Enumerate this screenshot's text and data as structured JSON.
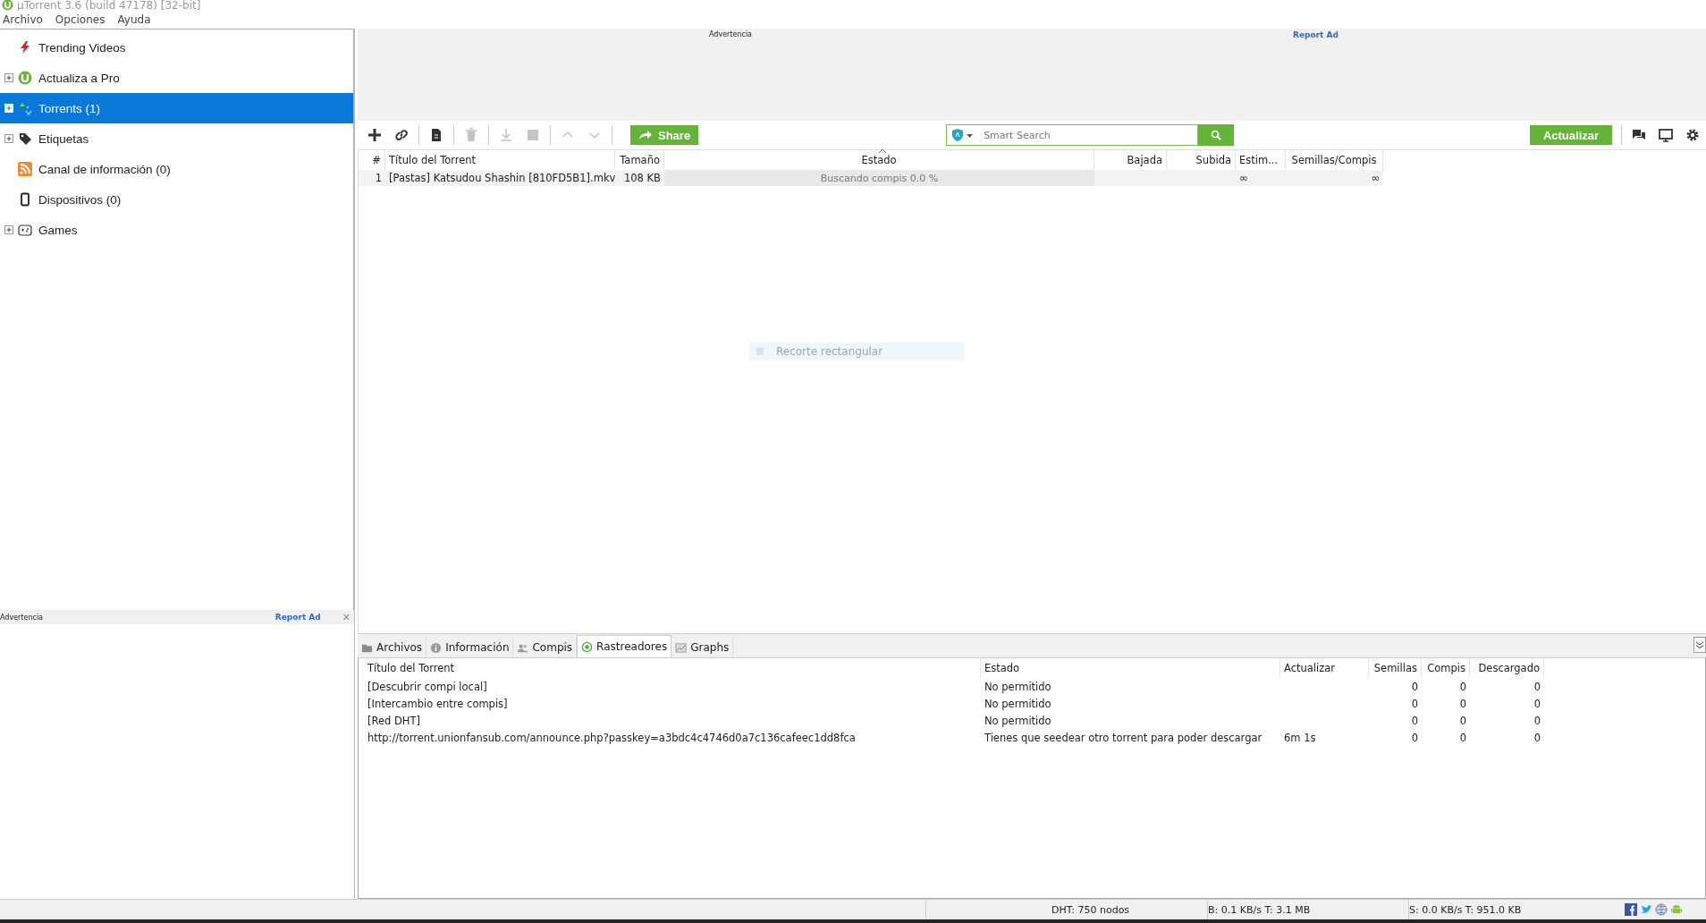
{
  "window": {
    "title": "µTorrent 3.6  (build 47178) [32-bit]"
  },
  "menu": [
    "Archivo",
    "Opciones",
    "Ayuda"
  ],
  "sidebar": {
    "items": [
      {
        "label": "Trending Videos",
        "kind": "bolt",
        "expandable": false,
        "selected": false
      },
      {
        "label": "Actualiza a Pro",
        "kind": "logo",
        "expandable": true,
        "selected": false
      },
      {
        "label": "Torrents (1)",
        "kind": "torrents",
        "expandable": true,
        "selected": true
      },
      {
        "label": "Etiquetas",
        "kind": "tag",
        "expandable": true,
        "selected": false
      },
      {
        "label": "Canal de información (0)",
        "kind": "rss",
        "expandable": false,
        "selected": false
      },
      {
        "label": "Dispositivos (0)",
        "kind": "phone",
        "expandable": false,
        "selected": false
      },
      {
        "label": "Games",
        "kind": "gamepad",
        "expandable": true,
        "selected": false
      }
    ]
  },
  "sidebar_ad": {
    "label": "Advertencia",
    "report": "Report Ad",
    "close": "✕"
  },
  "top_ad": {
    "label": "Advertencia",
    "report": "Report Ad"
  },
  "toolbar": {
    "buttons": [
      {
        "kind": "add",
        "disabled": false
      },
      {
        "kind": "link",
        "disabled": false
      },
      {
        "kind": "file",
        "disabled": false
      },
      {
        "kind": "trash",
        "disabled": true
      },
      {
        "kind": "download",
        "disabled": true
      },
      {
        "kind": "stop",
        "disabled": true
      },
      {
        "kind": "up",
        "disabled": true
      },
      {
        "kind": "down",
        "disabled": true
      }
    ],
    "share": "Share",
    "search": {
      "placeholder": "Smart Search"
    },
    "update": "Actualizar"
  },
  "torrents": {
    "columns": [
      {
        "label": "#",
        "sorted": false
      },
      {
        "label": "Título del Torrent",
        "sorted": false
      },
      {
        "label": "Tamaño",
        "sorted": false
      },
      {
        "label": "Estado",
        "sorted": true
      },
      {
        "label": "Bajada",
        "sorted": false
      },
      {
        "label": "Subida",
        "sorted": false
      },
      {
        "label": "Estim...",
        "sorted": false
      },
      {
        "label": "Semillas/Compis",
        "sorted": false
      }
    ],
    "rows": [
      {
        "number": "1",
        "name": "[Pastas] Katsudou Shashin [810FD5B1].mkv",
        "size": "108 KB",
        "status": "Buscando compis 0.0 %",
        "eta": "∞",
        "seeds": "∞"
      }
    ]
  },
  "overlay": {
    "label": "Recorte rectangular"
  },
  "detail_tabs": [
    {
      "label": "Archivos",
      "kind": "folder",
      "selected": false
    },
    {
      "label": "Información",
      "kind": "info",
      "selected": false
    },
    {
      "label": "Compis",
      "kind": "people",
      "selected": false
    },
    {
      "label": "Rastreadores",
      "kind": "target",
      "selected": true
    },
    {
      "label": "Graphs",
      "kind": "graph",
      "selected": false
    }
  ],
  "trackers": {
    "columns": [
      "Título del Torrent",
      "Estado",
      "Actualizar",
      "Semillas",
      "Compis",
      "Descargado"
    ],
    "rows": [
      {
        "name": "[Descubrir compi local]",
        "status": "No permitido",
        "seeds": "0",
        "peers": "0",
        "downloaded": "0"
      },
      {
        "name": "[Intercambio entre compis]",
        "status": "No permitido",
        "seeds": "0",
        "peers": "0",
        "downloaded": "0"
      },
      {
        "name": "[Red DHT]",
        "status": "No permitido",
        "seeds": "0",
        "peers": "0",
        "downloaded": "0"
      },
      {
        "name": "http://torrent.unionfansub.com/announce.php?passkey=a3bdc4c4746d0a7c136cafeec1dd8fca",
        "status": "Tienes que seedear otro torrent para poder descargar",
        "update": "6m 1s",
        "seeds": "0",
        "peers": "0",
        "downloaded": "0"
      }
    ]
  },
  "status_bar": {
    "dht": "DHT: 750 nodos",
    "download": "B: 0.1 KB/s T: 3.1 MB",
    "upload": "S: 0.0 KB/s T: 951.0 KB"
  }
}
